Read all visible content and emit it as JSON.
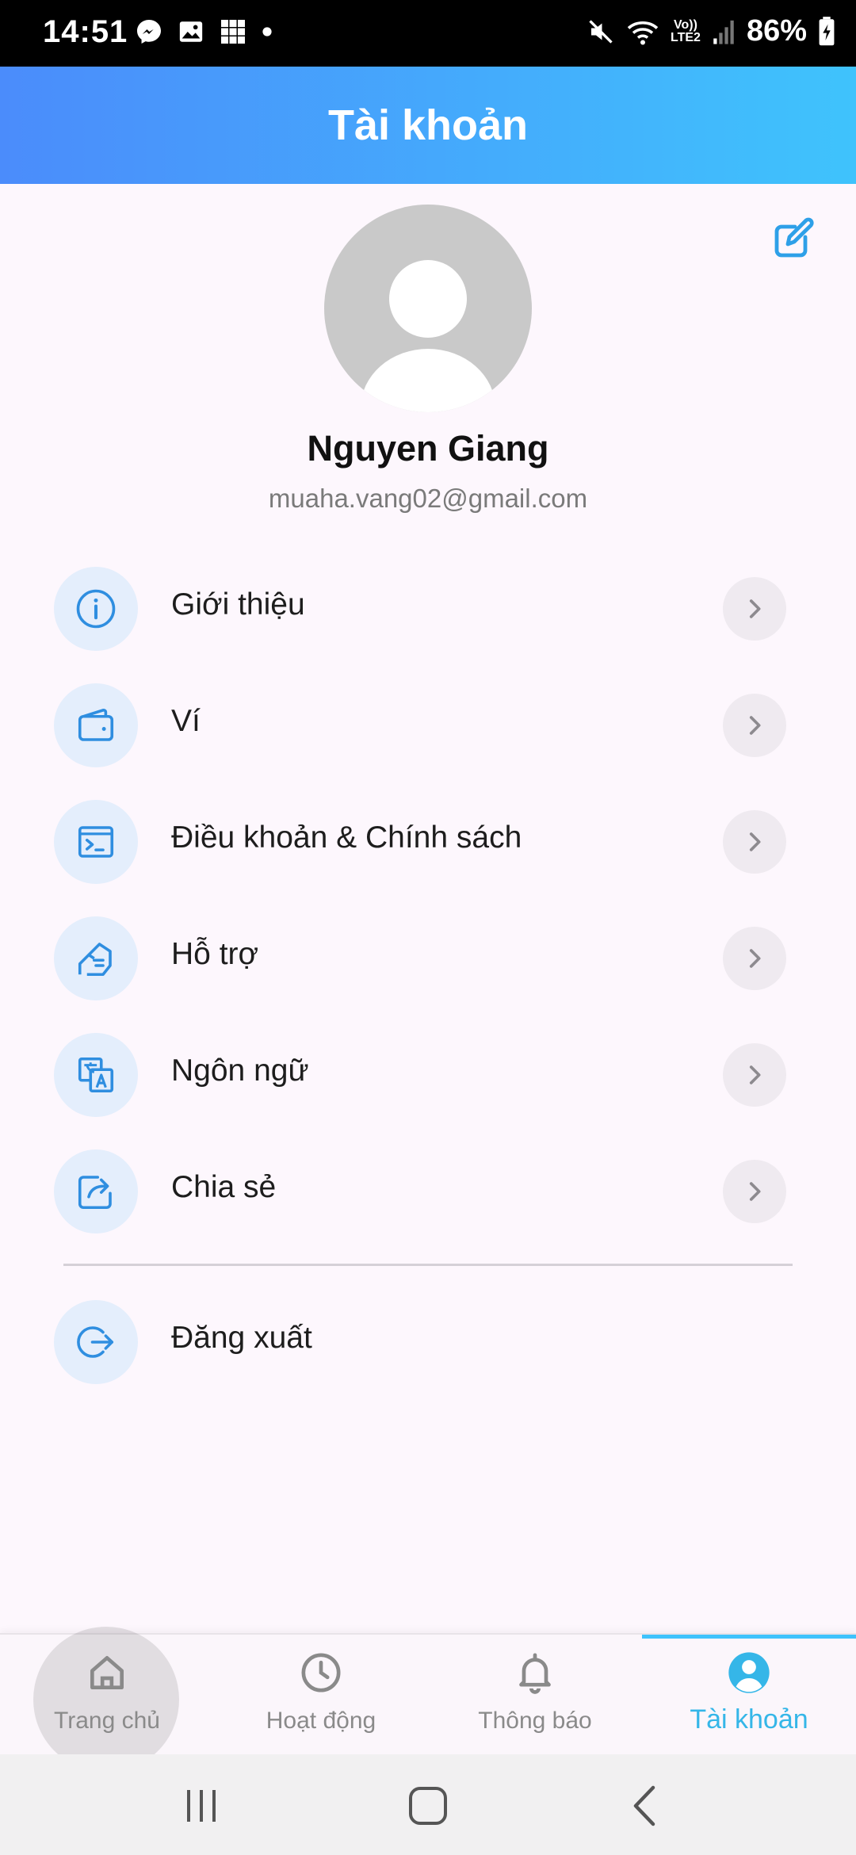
{
  "status_bar": {
    "time": "14:51",
    "battery_percent": "86%",
    "network_label_top": "Vo))",
    "network_label_bottom": "LTE2",
    "left_icons": [
      "messenger-icon",
      "gallery-icon",
      "grid-apps-icon",
      "dot-icon"
    ],
    "right_icons": [
      "mute-icon",
      "wifi-icon",
      "signal-icon",
      "battery-icon"
    ]
  },
  "header": {
    "title": "Tài khoản"
  },
  "profile": {
    "name": "Nguyen Giang",
    "email": "muaha.vang02@gmail.com",
    "edit_icon": "edit-icon"
  },
  "menu": {
    "items": [
      {
        "label": "Giới thiệu",
        "icon": "info-icon"
      },
      {
        "label": "Ví",
        "icon": "wallet-icon"
      },
      {
        "label": "Điều khoản & Chính sách",
        "icon": "terminal-icon"
      },
      {
        "label": "Hỗ trợ",
        "icon": "support-hand-icon"
      },
      {
        "label": "Ngôn ngữ",
        "icon": "translate-icon"
      },
      {
        "label": "Chia sẻ",
        "icon": "share-icon"
      }
    ],
    "logout": {
      "label": "Đăng xuất",
      "icon": "logout-icon"
    }
  },
  "bottom_nav": {
    "items": [
      {
        "label": "Trang chủ",
        "icon": "home-icon",
        "active": false
      },
      {
        "label": "Hoạt động",
        "icon": "clock-icon",
        "active": false
      },
      {
        "label": "Thông báo",
        "icon": "bell-icon",
        "active": false
      },
      {
        "label": "Tài khoản",
        "icon": "account-icon",
        "active": true
      }
    ]
  },
  "colors": {
    "header_gradient_start": "#4b8cfb",
    "header_gradient_end": "#3fc3fc",
    "accent": "#35b6e8",
    "icon_blue": "#2f8ee0",
    "icon_circle_bg": "#e4eefc"
  }
}
